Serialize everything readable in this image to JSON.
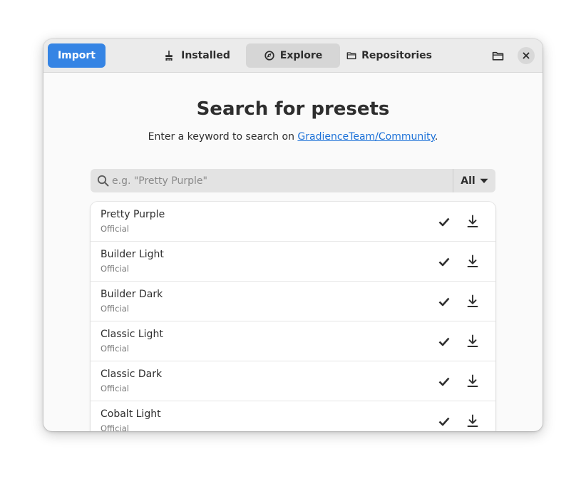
{
  "header": {
    "import_label": "Import",
    "tabs": [
      {
        "label": "Installed",
        "icon": "brush-icon",
        "active": false
      },
      {
        "label": "Explore",
        "icon": "compass-icon",
        "active": true
      },
      {
        "label": "Repositories",
        "icon": "folder-icon",
        "active": false
      }
    ],
    "folder_button_icon": "folder-icon",
    "close_button_icon": "close-icon"
  },
  "main": {
    "title": "Search for presets",
    "subtitle_prefix": "Enter a keyword to search on ",
    "subtitle_link": "GradienceTeam/Community",
    "subtitle_suffix": ".",
    "search": {
      "placeholder": "e.g. \"Pretty Purple\"",
      "value": "",
      "filter_value": "All"
    },
    "presets": [
      {
        "name": "Pretty Purple",
        "subtitle": "Official"
      },
      {
        "name": "Builder Light",
        "subtitle": "Official"
      },
      {
        "name": "Builder Dark",
        "subtitle": "Official"
      },
      {
        "name": "Classic Light",
        "subtitle": "Official"
      },
      {
        "name": "Classic Dark",
        "subtitle": "Official"
      },
      {
        "name": "Cobalt Light",
        "subtitle": "Official"
      }
    ]
  },
  "colors": {
    "accent": "#3584e4",
    "link": "#1c71d8",
    "headerbar": "#ebebeb",
    "window_bg": "#fafafa"
  }
}
